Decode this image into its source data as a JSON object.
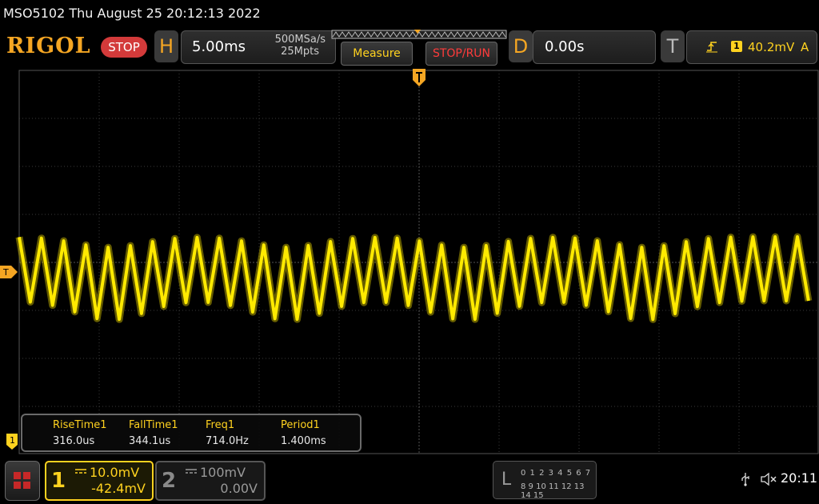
{
  "title_bar": {
    "text": "MSO5102  Thu August 25 20:12:13 2022"
  },
  "header": {
    "brand": "RIGOL",
    "run_status": "STOP",
    "horizontal": {
      "letter": "H",
      "timebase": "5.00ms",
      "sample_rate": "500MSa/s",
      "memory_depth": "25Mpts"
    },
    "measure_label": "Measure",
    "stoprun_label": "STOP/RUN",
    "delay": {
      "letter": "D",
      "value": "0.00s"
    },
    "trigger": {
      "letter": "T",
      "source": "1",
      "level": "40.2mV",
      "mode": "A"
    }
  },
  "markers": {
    "trigger_level": "T",
    "ch1": "1"
  },
  "measurements": [
    {
      "name": "RiseTime1",
      "value": "316.0us"
    },
    {
      "name": "FallTime1",
      "value": "344.1us"
    },
    {
      "name": "Freq1",
      "value": "714.0Hz"
    },
    {
      "name": "Period1",
      "value": "1.400ms"
    }
  ],
  "channels": {
    "ch1": {
      "number": "1",
      "scale": "10.0mV",
      "offset": "-42.4mV",
      "color": "#ffd21f"
    },
    "ch2": {
      "number": "2",
      "scale": "100mV",
      "offset": "0.00V",
      "color": "#8a8a8a"
    }
  },
  "logic": {
    "letter": "L",
    "row1": "0 1 2 3  4 5 6 7",
    "row2": "8 9 10 11 12 13 14 15"
  },
  "status": {
    "clock": "20:11"
  },
  "colors": {
    "accent": "#f5a623",
    "trace": "#ffe600",
    "grid": "#3a3a3a",
    "stop": "#d33a3a"
  },
  "icons": [
    "usb-icon",
    "speaker-mute-icon",
    "menu-grid-icon",
    "trigger-rising-edge-icon"
  ]
}
